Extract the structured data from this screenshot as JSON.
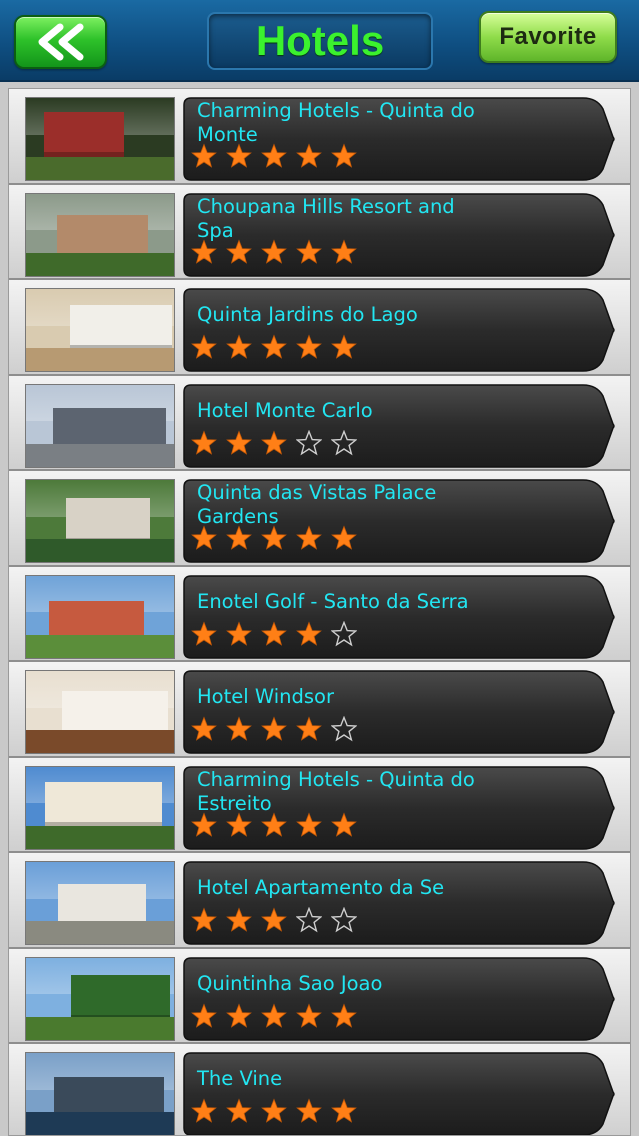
{
  "header": {
    "back_icon": "double-chevron-left-icon",
    "title": "Hotels",
    "favorite_label": "Favorite"
  },
  "colors": {
    "title_green": "#3bf22e",
    "name_cyan": "#22e6f2",
    "star_orange": "#ff7f16",
    "bubble_dark": "#2e2e2e"
  },
  "hotels": [
    {
      "name": "Charming Hotels - Quinta do Monte",
      "rating": 5,
      "thumb": [
        "#2b3b22",
        "#9b2e2a",
        "#4a6b2c"
      ]
    },
    {
      "name": "Choupana Hills Resort and Spa",
      "rating": 5,
      "thumb": [
        "#8c9a8a",
        "#b38a6a",
        "#3f6a2a"
      ]
    },
    {
      "name": "Quinta Jardins do Lago",
      "rating": 5,
      "thumb": [
        "#d9cbb0",
        "#f1efe9",
        "#b79a72"
      ]
    },
    {
      "name": "Hotel Monte Carlo",
      "rating": 3,
      "thumb": [
        "#b9c6d6",
        "#5c6470",
        "#7a7f84"
      ]
    },
    {
      "name": "Quinta das Vistas Palace Gardens",
      "rating": 5,
      "thumb": [
        "#4d7a3a",
        "#d8d2c6",
        "#2f5a2a"
      ]
    },
    {
      "name": "Enotel Golf - Santo da Serra",
      "rating": 4,
      "thumb": [
        "#6fa3d8",
        "#c65a3f",
        "#5b8e3a"
      ]
    },
    {
      "name": "Hotel Windsor",
      "rating": 4,
      "thumb": [
        "#e8dfd0",
        "#f5f1ea",
        "#7a4a2a"
      ]
    },
    {
      "name": "Charming Hotels - Quinta do Estreito",
      "rating": 5,
      "thumb": [
        "#4f8bd0",
        "#efe8d8",
        "#3e6a2a"
      ]
    },
    {
      "name": "Hotel Apartamento da Se",
      "rating": 3,
      "thumb": [
        "#6a9fd8",
        "#e9e6df",
        "#8a8a80"
      ]
    },
    {
      "name": "Quintinha Sao Joao",
      "rating": 5,
      "thumb": [
        "#7eb0e0",
        "#2f6a2a",
        "#4a7a2e"
      ]
    },
    {
      "name": "The Vine",
      "rating": 5,
      "thumb": [
        "#7aa0c8",
        "#3a4a5a",
        "#1e3a55"
      ]
    }
  ]
}
